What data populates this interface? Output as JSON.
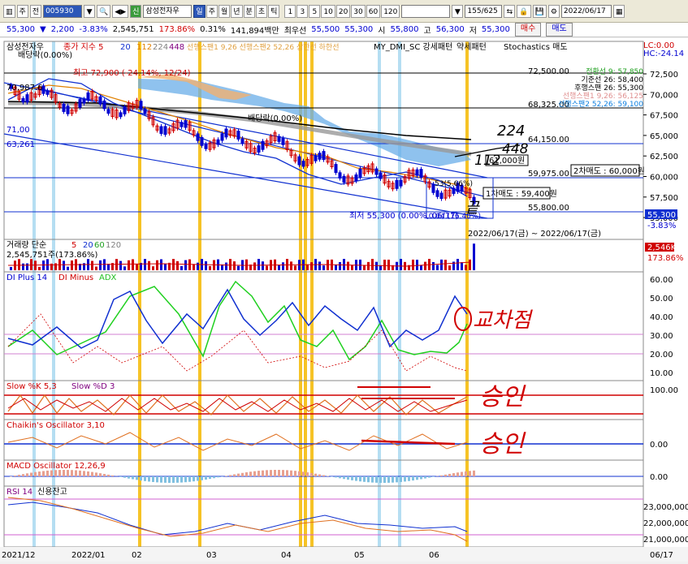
{
  "toolbar": {
    "mode_label": "주",
    "type_label": "전",
    "code": "005930",
    "stock_name": "삼성전자우",
    "period_buttons": [
      "일",
      "주",
      "월",
      "년",
      "분",
      "초",
      "틱"
    ],
    "active_period": "일",
    "interval_buttons": [
      "1",
      "3",
      "5",
      "10",
      "20",
      "30",
      "60",
      "120"
    ],
    "count_display": "155/625",
    "date_value": "2022/06/17"
  },
  "quote": {
    "price": "55,300",
    "change": "2,200",
    "change_pct": "-3.83%",
    "volume": "2,545,751",
    "volume_ratio": "173.86%",
    "turnover_pct": "0.31%",
    "trade_value": "141,894백만",
    "best_label": "최우선",
    "best_ask": "55,500",
    "best_bid": "55,300",
    "open_label": "시",
    "open": "55,800",
    "high_label": "고",
    "high": "56,300",
    "low_label": "저",
    "low": "55,300",
    "buy_label": "매수",
    "sell_label": "매도"
  },
  "price_pane": {
    "legend_name": "삼성전자우",
    "legend_ma": "종가 지수 5",
    "ma_periods": [
      "20",
      "112",
      "224",
      "448"
    ],
    "legend_extra": "선행스팬1 9,26  선행스팬2 52,26  상한선  하한선",
    "legend_dmi": "MY_DMI_SC 강세패턴",
    "legend_weak": "약세패턴",
    "legend_stoch": "Stochastics 매도",
    "dividend_label": "배당락(0.00%)",
    "dividend_label2": "배당락(0.00%)",
    "hi_annot": "최고 72,900 (-24.14%, 12/24)",
    "lo_annot": "최저 55,300 (0.00%, 06/17)",
    "left_price": "70,987.6",
    "left_price2": "71,00",
    "left_price3": "63,261",
    "ichimoku": [
      "전환선 9: 57,850",
      "기준선 26: 58,400",
      "후행스팬 26: 55,300",
      "선행스팬1 9,26: 56,125",
      "선행스팬2 52,26: 59,100"
    ],
    "levels": [
      "72,500.00",
      "68,325.00",
      "64,150.00",
      "61,000원",
      "59,975.00",
      "55,800.00"
    ],
    "first_sell": "1차매도 : 59,400원",
    "second_sell": "2차매도 : 60,000원",
    "mini_pct": "53(5.66%)",
    "mini_pct2": "10.04 (16.40%)",
    "date_range": "2022/06/17(금) ~ 2022/06/17(금)",
    "lc_label": "LC:0.00",
    "hc_label": "HC:-24.14",
    "current_price": "55,300",
    "current_pct": "-3.83%",
    "axis_ticks": [
      "72,500",
      "70,000",
      "67,500",
      "65,000",
      "62,500",
      "60,000",
      "57,500",
      "55,000"
    ]
  },
  "volume_pane": {
    "legend": "거래량 단순",
    "periods": [
      "5",
      "20",
      "60",
      "120"
    ],
    "value": "2,545,751주(173.86%)",
    "right_value": "2,546K",
    "right_pct": "173.86%"
  },
  "dmi_pane": {
    "legend": [
      "DI Plus 14",
      "DI Minus",
      "ADX"
    ],
    "ticks": [
      "60.00",
      "50.00",
      "40.00",
      "30.00",
      "20.00",
      "10.00"
    ]
  },
  "stoch_pane": {
    "legend": [
      "Slow %K 5,3",
      "Slow %D 3"
    ],
    "ticks": [
      "100.00"
    ]
  },
  "chaikin_pane": {
    "legend": "Chaikin's Oscillator 3,10",
    "ticks": [
      "0.00"
    ]
  },
  "macd_pane": {
    "legend": "MACD Oscillator 12,26,9",
    "ticks": [
      "0.00"
    ]
  },
  "rsi_pane": {
    "legend": [
      "RSI 14",
      "신용잔고"
    ],
    "ticks": [
      "23,000,000",
      "22,000,000",
      "21,000,000"
    ]
  },
  "xaxis": {
    "labels": [
      "2021/12",
      "2022/01",
      "02",
      "03",
      "04",
      "05",
      "06",
      "06/17"
    ]
  },
  "handwriting": {
    "note_224": "224",
    "note_448": "448",
    "note_112": "112",
    "note_kkeut": "끝",
    "note_dmi": "교차점",
    "note_stoch": "승인",
    "note_chaikin": "승인"
  },
  "colors": {
    "up": "#d00000",
    "down": "#0000d0",
    "ma5": "#e23030",
    "ma20": "#1030d0",
    "ma112": "#e08000",
    "ma224": "#808080",
    "ma448": "#000000",
    "highlight": "#f5b800",
    "cloud": "#6aaee8",
    "cloud2": "#f0b070"
  }
}
